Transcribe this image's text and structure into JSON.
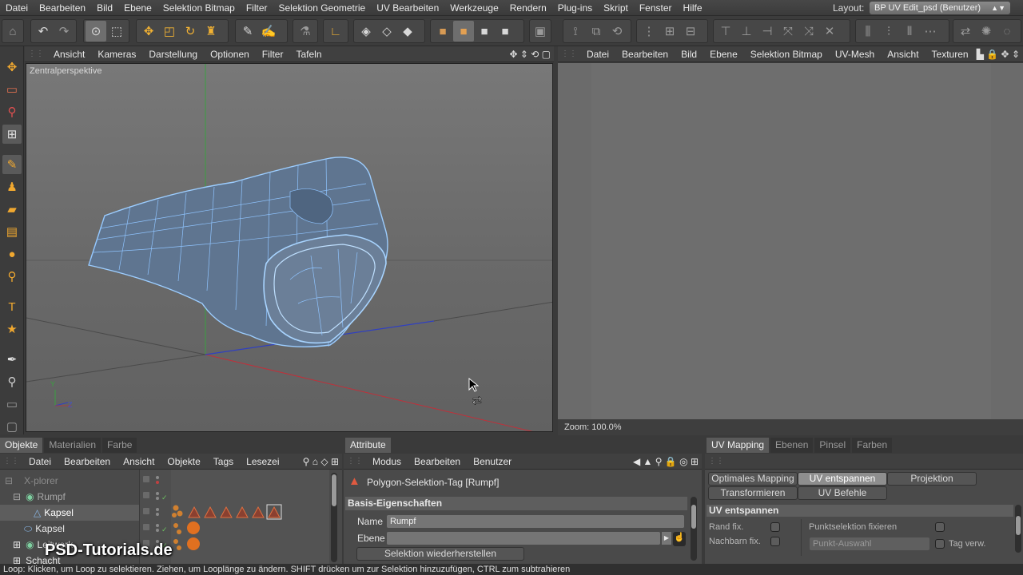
{
  "menubar": {
    "items": [
      "Datei",
      "Bearbeiten",
      "Bild",
      "Ebene",
      "Selektion Bitmap",
      "Filter",
      "Selektion Geometrie",
      "UV Bearbeiten",
      "Werkzeuge",
      "Rendern",
      "Plug-ins",
      "Skript",
      "Fenster",
      "Hilfe"
    ],
    "layout_label": "Layout:",
    "layout_value": "BP UV Edit_psd (Benutzer)"
  },
  "viewport": {
    "menu": [
      "Ansicht",
      "Kameras",
      "Darstellung",
      "Optionen",
      "Filter",
      "Tafeln"
    ],
    "label": "Zentralperspektive",
    "axis_y": "Y",
    "axis_z": "Z"
  },
  "uv_view": {
    "menu": [
      "Datei",
      "Bearbeiten",
      "Bild",
      "Ebene",
      "Selektion Bitmap",
      "UV-Mesh",
      "Ansicht",
      "Texturen"
    ],
    "zoom": "Zoom: 100.0%"
  },
  "objects_panel": {
    "tabs": [
      "Objekte",
      "Materialien",
      "Farbe"
    ],
    "menu": [
      "Datei",
      "Bearbeiten",
      "Ansicht",
      "Objekte",
      "Tags",
      "Lesezei"
    ],
    "rows": [
      "X-plorer",
      "Rumpf",
      "Kapsel",
      "Kapsel",
      "Leitwerk",
      "Schacht"
    ]
  },
  "attribute_panel": {
    "tab": "Attribute",
    "menu": [
      "Modus",
      "Bearbeiten",
      "Benutzer"
    ],
    "title": "Polygon-Selektion-Tag [Rumpf]",
    "section": "Basis-Eigenschaften",
    "name_label": "Name",
    "name_value": "Rumpf",
    "layer_label": "Ebene",
    "restore_button": "Selektion wiederherstellen"
  },
  "uv_mapping_panel": {
    "tabs": [
      "UV Mapping",
      "Ebenen",
      "Pinsel",
      "Farben"
    ],
    "buttons_row1": [
      "Optimales Mapping",
      "UV entspannen",
      "Projektion"
    ],
    "buttons_row2": [
      "Transformieren",
      "UV Befehle"
    ],
    "section": "UV entspannen",
    "pin_border": "Rand fix.",
    "pin_neighbors": "Nachbarn fix.",
    "fix_point_selection": "Punktselektion fixieren",
    "point_select_placeholder": "Punkt-Auswahl",
    "tag_use": "Tag verw."
  },
  "status": "Loop: Klicken, um Loop zu selektieren. Ziehen, um Looplänge zu ändern. SHIFT drücken um zur Selektion hinzuzufügen, CTRL zum subtrahieren",
  "watermark": "PSD-Tutorials.de",
  "colors": {
    "accent": "#f0a830",
    "mesh_wire": "#8fc4ff",
    "axis_x": "#c0303a",
    "axis_y": "#3aa040",
    "axis_z": "#3040c0"
  }
}
